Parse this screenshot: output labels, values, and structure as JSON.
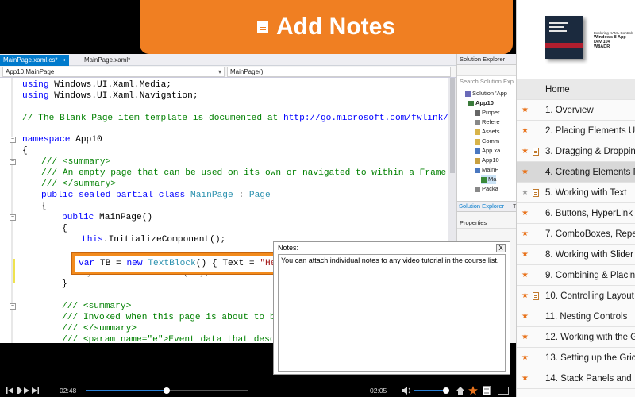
{
  "banner": {
    "title": "Add Notes",
    "icon": "note-icon"
  },
  "editor": {
    "tabs": [
      {
        "label": "MainPage.xaml.cs*",
        "close": "×"
      },
      {
        "label": "MainPage.xaml*"
      }
    ],
    "nav_left": "App10.MainPage",
    "nav_right": "MainPage()",
    "line_using1_kw": "using",
    "line_using1_rest": " Windows.UI.Xaml.Media;",
    "line_using2_kw": "using",
    "line_using2_rest": " Windows.UI.Xaml.Navigation;",
    "line_comment_a": "// The Blank Page item template is documented at ",
    "line_comment_link": "http://go.microsoft.com/fwlink/?Lin",
    "line_ns_kw": "namespace",
    "line_ns_rest": " App10",
    "line_brace": "{",
    "line_summary_open": "/// <summary>",
    "line_summary_text": "/// An empty page that can be used on its own or navigated to within a Frame.",
    "line_summary_close": "/// </summary>",
    "line_class_kw": "public sealed partial class ",
    "line_class_name": "MainPage",
    "line_class_sep": " : ",
    "line_class_base": "Page",
    "line_brace2": "{",
    "line_ctor_kw": "public",
    "line_ctor_rest": " MainPage()",
    "line_brace3": "{",
    "line_this_kw": "this",
    "line_this_rest": ".InitializeComponent();",
    "line_hidden": "myGrid.Children.Add(TB);",
    "line_brace_close": "}",
    "line_summary2_open": "/// <summary>",
    "line_invoked": "/// Invoked when this page is about to be",
    "line_summary2_close": "/// </summary>",
    "line_param": "/// <param name=\"e\">Event data that descri",
    "highlight": {
      "kw1": "var",
      "mid": " TB = ",
      "kw2": "new",
      "sp": " ",
      "type": "TextBlock",
      "rest": "() { Text = ",
      "str": "\"Hel"
    }
  },
  "solution_explorer": {
    "title": "Solution Explorer",
    "search_placeholder": "Search Solution Exp",
    "items": [
      "Solution 'App",
      "App10",
      "Proper",
      "Refere",
      "Assets",
      "Comm",
      "App.xa",
      "App10",
      "MainP",
      "Ma",
      "Packa"
    ],
    "tab_solution": "Solution Explorer",
    "tab_team": "T",
    "properties": "Properties"
  },
  "notes": {
    "label": "Notes:",
    "close": "X",
    "text": "You can attach individual notes to any video tutorial in the course list."
  },
  "player": {
    "elapsed": "02:48",
    "remaining": "02:05",
    "progress_fraction": 0.5,
    "volume_fraction": 0.9,
    "controls": [
      "prev-icon",
      "play-icon",
      "next-icon",
      "volume-icon",
      "home-icon",
      "star-icon",
      "note-icon",
      "fullscreen-icon"
    ]
  },
  "sidebar": {
    "course_title_small": "Exploring XAML Controls",
    "course_title": "Windows 8 App Dev 104",
    "course_code": "W8ADR",
    "home": "Home",
    "lessons": [
      {
        "label": "1. Overview",
        "star": "orange",
        "note": false
      },
      {
        "label": "2. Placing Elements U",
        "star": "orange",
        "note": false
      },
      {
        "label": "3. Dragging & Droppin",
        "star": "orange",
        "note": true
      },
      {
        "label": "4. Creating Elements P",
        "star": "orange",
        "note": false
      },
      {
        "label": "5. Working with Text",
        "star": "gray",
        "note": true
      },
      {
        "label": "6. Buttons, HyperLink",
        "star": "orange",
        "note": false
      },
      {
        "label": "7. ComboBoxes, Repe",
        "star": "orange",
        "note": false
      },
      {
        "label": "8. Working with Slider",
        "star": "orange",
        "note": false
      },
      {
        "label": "9. Combining & Placin",
        "star": "orange",
        "note": false
      },
      {
        "label": "10. Controlling Layout",
        "star": "orange",
        "note": true
      },
      {
        "label": "11. Nesting Controls",
        "star": "orange",
        "note": false
      },
      {
        "label": "12. Working with the G",
        "star": "orange",
        "note": false
      },
      {
        "label": "13. Setting up the Gric",
        "star": "orange",
        "note": false
      },
      {
        "label": "14. Stack Panels and",
        "star": "orange",
        "note": false
      }
    ],
    "selected_index": 3,
    "colors": {
      "accent": "#f07f22",
      "star_orange": "#e8731c",
      "star_gray": "#a0a0a0"
    }
  }
}
